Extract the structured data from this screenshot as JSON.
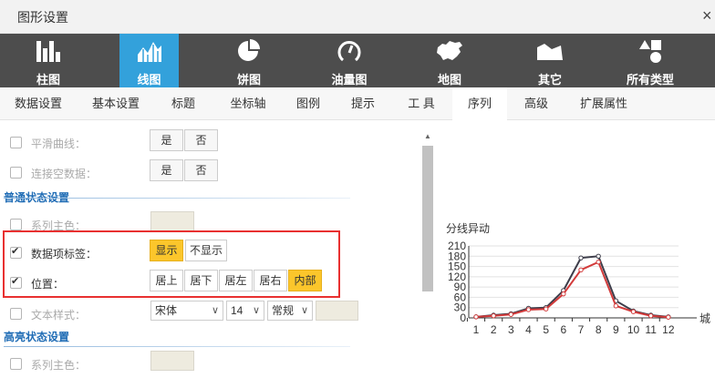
{
  "window": {
    "title": "图形设置",
    "close_glyph": "×"
  },
  "chart_types": [
    {
      "label": "柱图",
      "icon": "bar-chart-icon",
      "active": false
    },
    {
      "label": "线图",
      "icon": "line-chart-icon",
      "active": true
    },
    {
      "label": "饼图",
      "icon": "pie-chart-icon",
      "active": false
    },
    {
      "label": "油量图",
      "icon": "gauge-icon",
      "active": false
    },
    {
      "label": "地图",
      "icon": "china-map-icon",
      "active": false
    },
    {
      "label": "其它",
      "icon": "area-shape-icon",
      "active": false
    },
    {
      "label": "所有类型",
      "icon": "shapes-icon",
      "active": false
    }
  ],
  "tabs": [
    {
      "label": "数据设置"
    },
    {
      "label": "基本设置"
    },
    {
      "label": "标题"
    },
    {
      "label": "坐标轴"
    },
    {
      "label": "图例"
    },
    {
      "label": "提示"
    },
    {
      "label": "工 具"
    },
    {
      "label": "序列",
      "active": true
    },
    {
      "label": "高级"
    },
    {
      "label": "扩展属性"
    }
  ],
  "settings": {
    "smooth": {
      "label": "平滑曲线：",
      "opt_yes": "是",
      "opt_no": "否",
      "checked": false
    },
    "connect_nulls": {
      "label": "连接空数据：",
      "opt_yes": "是",
      "opt_no": "否",
      "checked": false
    },
    "normal_section": "普通状态设置",
    "series_color": {
      "label": "系列主色：",
      "checked": false
    },
    "data_label": {
      "label": "数据项标签：",
      "opt_show": "显示",
      "opt_hide": "不显示",
      "checked": true,
      "selected": "显示"
    },
    "position": {
      "label": "位置：",
      "options": [
        "居上",
        "居下",
        "居左",
        "居右",
        "内部"
      ],
      "checked": true,
      "selected": "内部"
    },
    "text_style": {
      "label": "文本样式：",
      "font": "宋体",
      "size": "14",
      "weight": "常规",
      "checked": false
    },
    "highlight_section": "高亮状态设置",
    "hl_series_color": {
      "label": "系列主色：",
      "checked": false
    }
  },
  "chart_data": {
    "type": "line",
    "title": "分线异动",
    "categories": [
      "1",
      "2",
      "3",
      "4",
      "5",
      "6",
      "7",
      "8",
      "9",
      "10",
      "11",
      "12"
    ],
    "x_extra_label": "城",
    "ylim": [
      0,
      210
    ],
    "yticks": [
      0,
      30,
      60,
      90,
      120,
      150,
      180,
      210
    ],
    "series": [
      {
        "color": "#3d3d4a",
        "values": [
          3,
          8,
          12,
          28,
          30,
          80,
          175,
          180,
          50,
          20,
          8,
          3
        ]
      },
      {
        "color": "#d23a3a",
        "values": [
          3,
          6,
          10,
          24,
          26,
          70,
          140,
          163,
          35,
          18,
          6,
          2
        ]
      }
    ]
  }
}
